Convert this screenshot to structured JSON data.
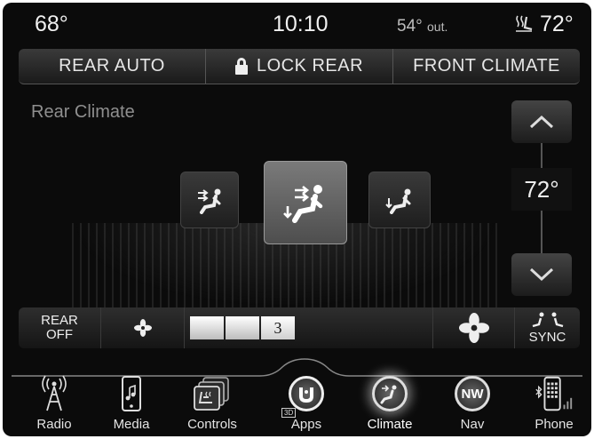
{
  "status": {
    "temp_left": "68°",
    "clock": "10:10",
    "outside_temp": "54°",
    "outside_label": "out.",
    "temp_right": "72°"
  },
  "topbar": {
    "rear_auto": "REAR AUTO",
    "lock_rear": "LOCK REAR",
    "front_climate": "FRONT CLIMATE"
  },
  "main": {
    "title": "Rear Climate",
    "active_mode": "bilevel",
    "set_temp": "72°"
  },
  "fan": {
    "rear_off_line1": "REAR",
    "rear_off_line2": "OFF",
    "speed": "3",
    "speed_level": 3,
    "speed_max": 7,
    "sync_label": "SYNC"
  },
  "nav": {
    "active": "Climate",
    "items": [
      {
        "label": "Radio",
        "icon": "radio-tower-icon"
      },
      {
        "label": "Media",
        "icon": "media-phone-icon"
      },
      {
        "label": "Controls",
        "icon": "controls-seat-icon"
      },
      {
        "label": "Apps",
        "icon": "apps-uconnect-icon"
      },
      {
        "label": "Climate",
        "icon": "climate-icon"
      },
      {
        "label": "Nav",
        "icon": "compass-icon"
      },
      {
        "label": "Phone",
        "icon": "phone-icon"
      }
    ],
    "compass_heading": "NW",
    "apps_tag": "3D"
  }
}
